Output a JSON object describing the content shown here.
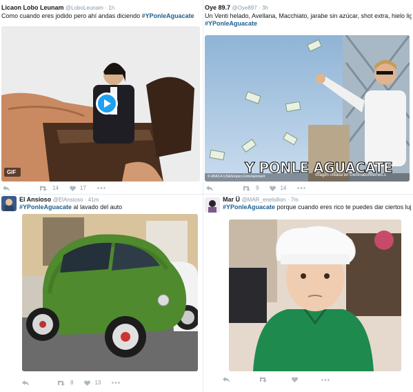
{
  "tweets": [
    {
      "name": "Licaon Lobo Leunam",
      "handle": "@LoboLeunam",
      "time": "· 1h",
      "text": "Como cuando eres jodido pero ahí andas diciendo",
      "hashtag": "#YPonleAguacate",
      "gif_label": "GIF",
      "retweets": "14",
      "likes": "17"
    },
    {
      "name": "Oye 89.7",
      "handle": "@Oye897",
      "time": "· 3h",
      "text": "Un Venti helado, Avellana, Macchiato, jarabe sin azúcar, shot extra, hielo light",
      "hashtag": "#YPonleAguacate",
      "caption": "Y PONLE AGUACATE",
      "credit": "© ABACA USA/Empics Entertainment",
      "watermark": "Imagen creada en GeneradorMemes.c",
      "retweets": "9",
      "likes": "14"
    },
    {
      "name": "El Ansioso",
      "handle": "@ElAnsioso",
      "time": "· 41m",
      "hashtag": "#YPonleAguacate",
      "text": "al lavado del auto",
      "retweets": "8",
      "likes": "13"
    },
    {
      "name": "Mar Ü",
      "handle": "@MAR_enelsillon",
      "time": "· 7m",
      "hashtag": "#YPonleAguacate",
      "text": "porque cuando eres rico te puedes dar ciertos lujos"
    }
  ],
  "icons": {
    "reply": "reply-icon",
    "retweet": "retweet-icon",
    "like": "heart-icon",
    "more": "more-icon",
    "play": "play-icon"
  },
  "colors": {
    "hashtag": "#1b5e8f",
    "meta": "#8899a6",
    "play": "#1da1f2"
  }
}
